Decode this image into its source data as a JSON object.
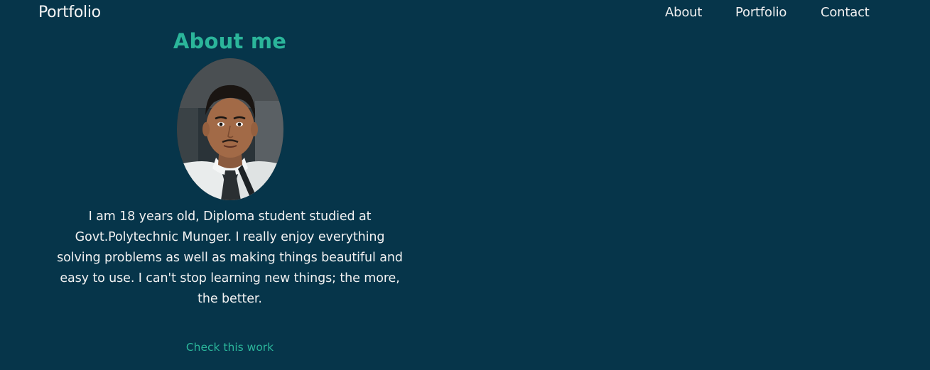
{
  "nav": {
    "brand": "Portfolio",
    "links": [
      "About",
      "Portfolio",
      "Contact"
    ]
  },
  "about": {
    "title": "About me",
    "bio": "I am 18 years old, Diploma student studied at Govt.Polytechnic Munger. I really enjoy everything solving problems as well as making things beautiful and easy to use. I can't stop learning new things; the more, the better.",
    "cta_label": "Check this work"
  },
  "colors": {
    "background": "#06354a",
    "accent": "#2bb59a",
    "text": "#f2f2f2"
  }
}
